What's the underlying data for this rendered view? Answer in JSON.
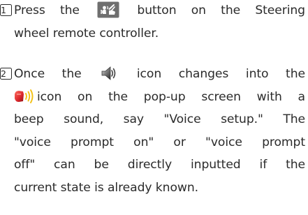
{
  "steps": [
    {
      "number": "1",
      "lines": [
        [
          "Press the",
          "button on the Steering"
        ],
        [
          "wheel remote controller."
        ]
      ],
      "icons": [
        "voice-button-icon"
      ]
    },
    {
      "number": "2",
      "lines": [
        [
          "Once the",
          "icon changes into the"
        ],
        [
          "icon on the pop-up screen with a"
        ],
        [
          "beep sound, say \"Voice setup.\" The"
        ],
        [
          "\"voice prompt on\" or \"voice prompt"
        ],
        [
          "off\" can be directly inputted if the"
        ],
        [
          "current state is already known."
        ]
      ],
      "icons": [
        "speaker-icon",
        "microphone-icon"
      ]
    }
  ],
  "colors": {
    "text": "#2b2b2b",
    "voice_button_bg": "#6f6f6f",
    "mic_red": "#d9262b",
    "wave_yellow": "#f3c21a"
  }
}
